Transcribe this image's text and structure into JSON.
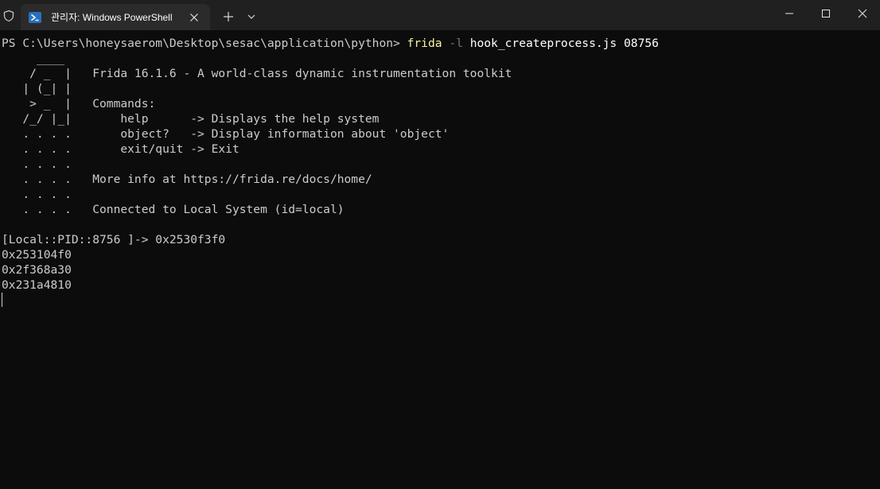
{
  "window": {
    "tab_title": "관리자: Windows PowerShell",
    "icons": {
      "shield": "shield-icon",
      "powershell": "powershell-icon",
      "close_tab": "close-icon",
      "new_tab": "plus-icon",
      "dropdown": "chevron-down-icon",
      "minimize": "minimize-icon",
      "maximize": "maximize-icon",
      "close_window": "close-icon"
    }
  },
  "terminal": {
    "prompt": "PS C:\\Users\\honeysaerom\\Desktop\\sesac\\application\\python> ",
    "command": {
      "name": "frida",
      "flag": " -l ",
      "args": "hook_createprocess.js 08756"
    },
    "banner": [
      "     ____",
      "    / _  |   Frida 16.1.6 - A world-class dynamic instrumentation toolkit",
      "   | (_| |",
      "    > _  |   Commands:",
      "   /_/ |_|       help      -> Displays the help system",
      "   . . . .       object?   -> Display information about 'object'",
      "   . . . .       exit/quit -> Exit",
      "   . . . .",
      "   . . . .   More info at https://frida.re/docs/home/",
      "   . . . .",
      "   . . . .   Connected to Local System (id=local)"
    ],
    "output": [
      "[Local::PID::8756 ]-> 0x2530f3f0",
      "0x253104f0",
      "0x2f368a30",
      "0x231a4810"
    ]
  },
  "colors": {
    "background": "#0c0c0c",
    "titlebar": "#202020",
    "tab_active": "#2b2b2b",
    "text": "#cccccc",
    "command_highlight": "#f9f1a5",
    "flag_dim": "#767676"
  }
}
